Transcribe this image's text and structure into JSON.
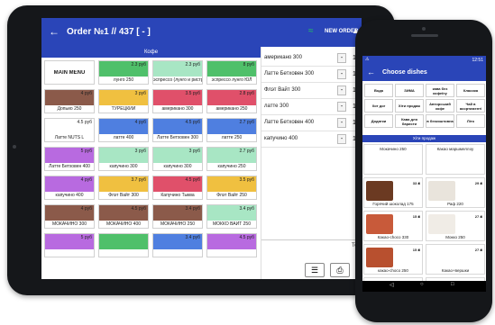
{
  "tablet": {
    "title": "Order №1 // 437 [ - ]",
    "new_order": "NEW ORDER",
    "category": "Кофе",
    "tiles": [
      {
        "name": "MAIN MENU",
        "price": "",
        "color": "#ffffff",
        "menu": true
      },
      {
        "name": "лунго 250",
        "price": "2.3 руб",
        "color": "#4fc06a"
      },
      {
        "name": "эспрессо (лунго и ристретто)",
        "price": "2.3 руб",
        "color": "#a8e6c4"
      },
      {
        "name": "эспрессо лунго ЮЛ",
        "price": "8 руб",
        "color": "#4fc06a"
      },
      {
        "name": "Допьио 250",
        "price": "4 руб",
        "color": "#8b5a4a"
      },
      {
        "name": "ТУРЕЦКИЙ",
        "price": "3 руб",
        "color": "#f0c040"
      },
      {
        "name": "американо 300",
        "price": "3.5 руб",
        "color": "#e0506a"
      },
      {
        "name": "американо 250",
        "price": "2.8 руб",
        "color": "#e0506a"
      },
      {
        "name": "Латте NUTS L",
        "price": "4.5 руб",
        "color": "#ffffff"
      },
      {
        "name": "латте 400",
        "price": "4 руб",
        "color": "#4f7fe0"
      },
      {
        "name": "Латте Бетховен 300",
        "price": "4.5 руб",
        "color": "#4f7fe0"
      },
      {
        "name": "латте 250",
        "price": "2.7 руб",
        "color": "#4f7fe0"
      },
      {
        "name": "Латте Бетховен 400",
        "price": "5 руб",
        "color": "#b86ae0"
      },
      {
        "name": "капучино 300",
        "price": "3 руб",
        "color": "#a8e6c4"
      },
      {
        "name": "капучино 300",
        "price": "3 руб",
        "color": "#a8e6c4"
      },
      {
        "name": "капучино 250",
        "price": "2.7 руб",
        "color": "#a8e6c4"
      },
      {
        "name": "капучино 400",
        "price": "4 руб",
        "color": "#b86ae0"
      },
      {
        "name": "Флэт Вайт 300",
        "price": "3.7 руб",
        "color": "#f0c040"
      },
      {
        "name": "Капучино Тыква",
        "price": "4.5 руб",
        "color": "#e0506a"
      },
      {
        "name": "Флэт Вайт 250",
        "price": "3.5 руб",
        "color": "#f0c040"
      },
      {
        "name": "МОКАЧИНО 300",
        "price": "4 руб",
        "color": "#8b5a4a"
      },
      {
        "name": "МОКАЧИНО 400",
        "price": "4.5 руб",
        "color": "#8b5a4a"
      },
      {
        "name": "МОКАЧИНО 250",
        "price": "3.4 руб",
        "color": "#8b5a4a"
      },
      {
        "name": "МОККО ВАЙТ 250",
        "price": "3.4 руб",
        "color": "#a8e6c4"
      },
      {
        "name": "",
        "price": "5 руб",
        "color": "#b86ae0"
      },
      {
        "name": "",
        "price": "",
        "color": "#4fc06a"
      },
      {
        "name": "",
        "price": "3.4 руб",
        "color": "#4f7fe0"
      },
      {
        "name": "",
        "price": "4.5 руб",
        "color": "#b86ae0"
      }
    ],
    "order_lines": [
      {
        "name": "американо 300",
        "qty": "1"
      },
      {
        "name": "Латте Бетховен 300",
        "qty": "1"
      },
      {
        "name": "Флэт Вайт 300",
        "qty": "1"
      },
      {
        "name": "латте 300",
        "qty": "1"
      },
      {
        "name": "Латте Бетховен 400",
        "qty": "1"
      },
      {
        "name": "капучино 400",
        "qty": "1"
      }
    ],
    "total_label": "То"
  },
  "phone": {
    "time": "12:51",
    "title": "Choose dishes",
    "categories": [
      "Вода",
      "ЗИМА",
      "кава без кофеїну",
      "Класика",
      "Хот дог",
      "Хіти продаж",
      "Авторський кофе",
      "Чай в асортименті",
      "Додатки",
      "Кава для баристи",
      "в безкоштовна",
      "Літо"
    ],
    "section": "Хіти продаж",
    "items": [
      {
        "name": "Мокачино 250",
        "price": "",
        "img": "",
        "name_top": true
      },
      {
        "name": "Какао маршмеллоу",
        "price": "",
        "img": "",
        "name_top": true
      },
      {
        "name": "Горячий шоколад 175",
        "price": "33 ₴",
        "img": "#6b3a22"
      },
      {
        "name": "Раф 220",
        "price": "29 ₴",
        "img": "#e9e4dc"
      },
      {
        "name": "Какао-choco 330",
        "price": "15 ₴",
        "img": "#c85a3a"
      },
      {
        "name": "Мокко 250",
        "price": "27 ₴",
        "img": "#f0ece6"
      },
      {
        "name": "какао-choco 250",
        "price": "15 ₴",
        "img": "#b8502f"
      },
      {
        "name": "Какао+вершки",
        "price": "27 ₴",
        "img": "#ffffff"
      },
      {
        "name": "",
        "price": "33 ₴",
        "img": "#ffffff"
      },
      {
        "name": "",
        "price": "33 ₴",
        "img": "#ffffff"
      }
    ]
  }
}
